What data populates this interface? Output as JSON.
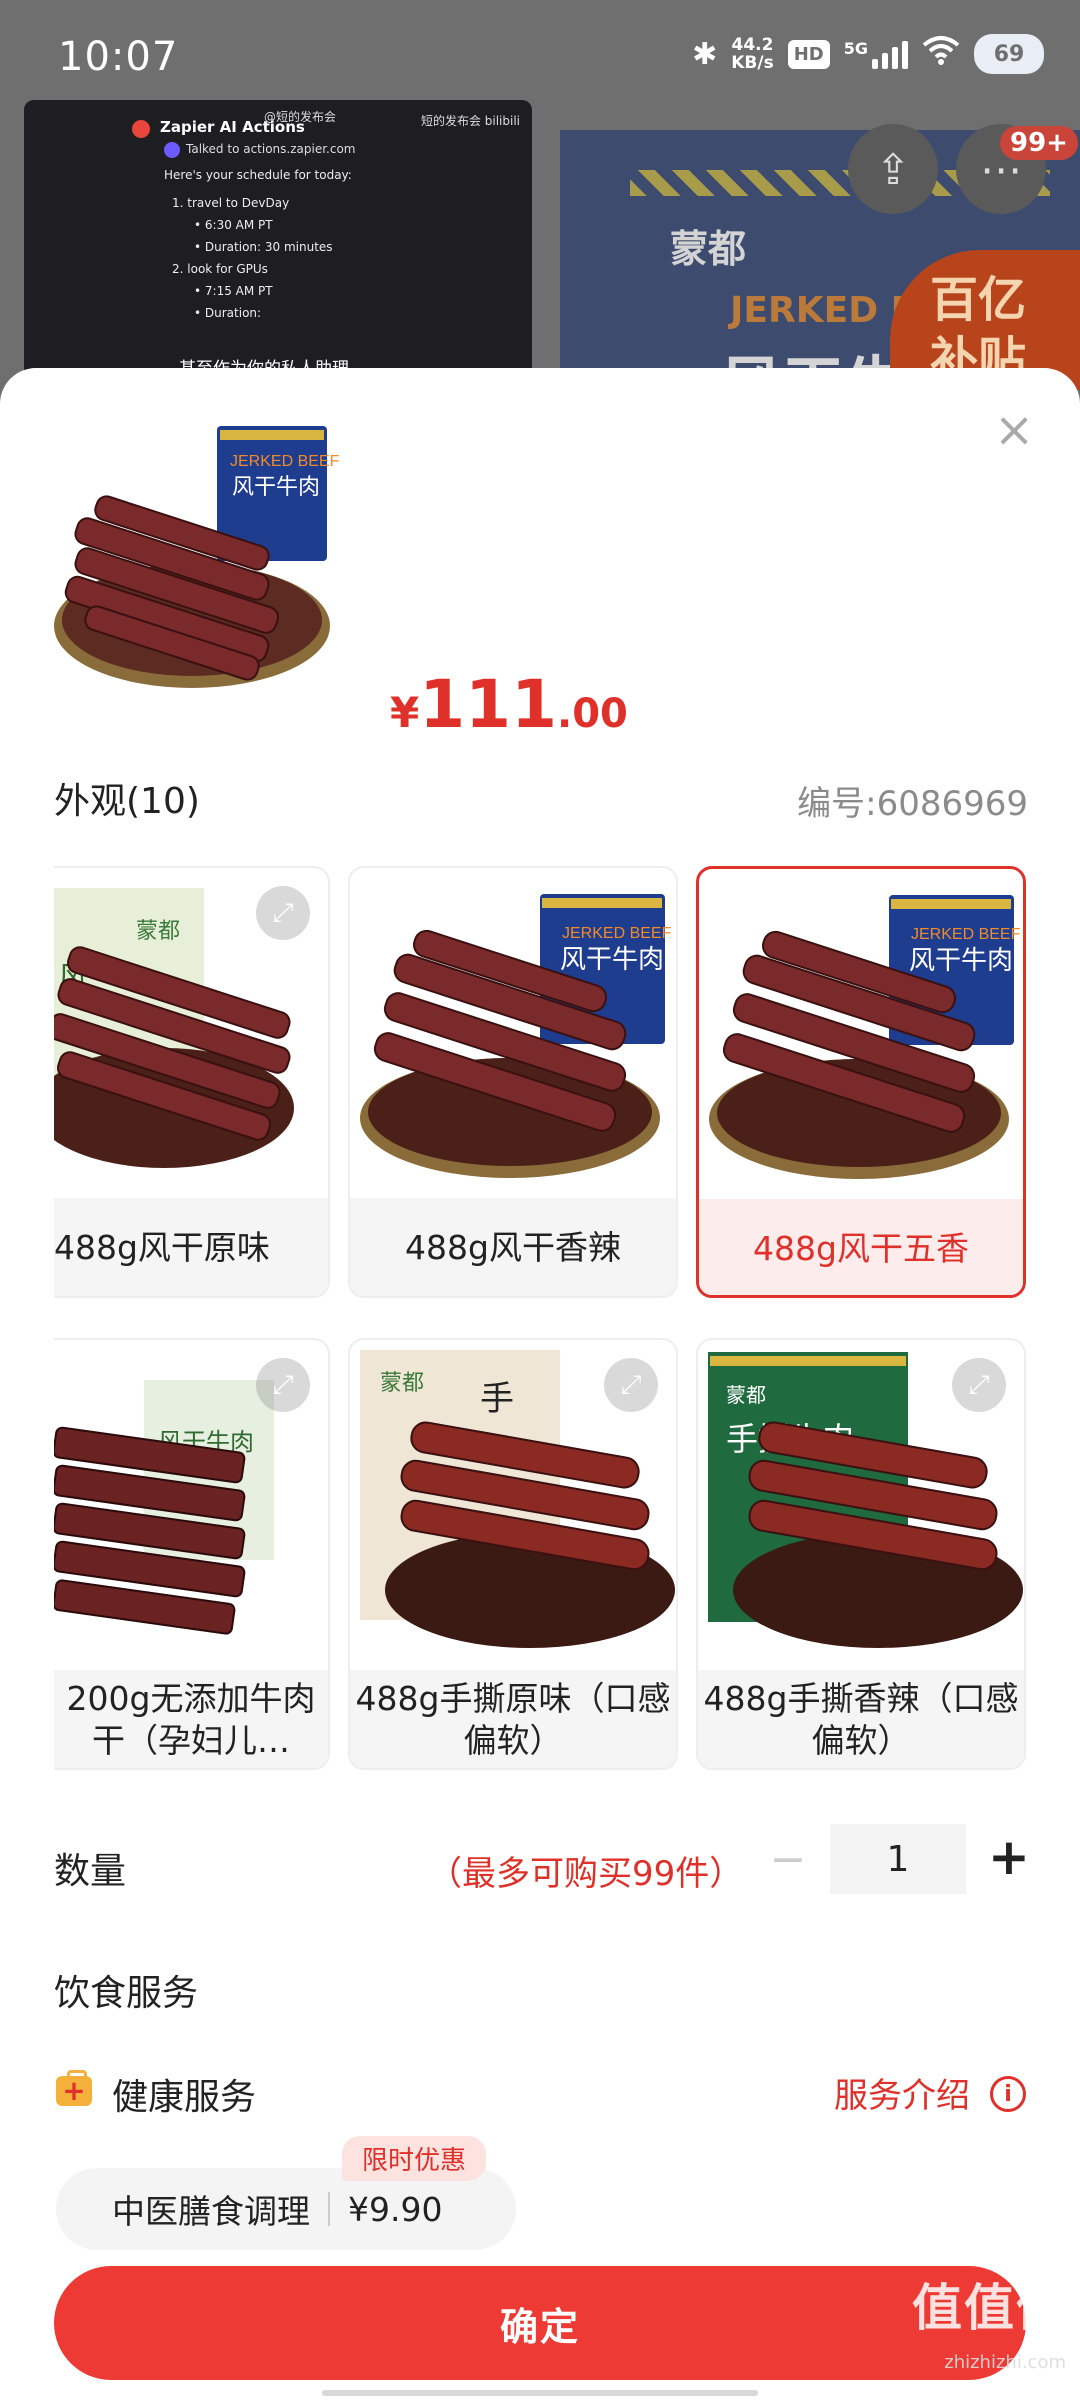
{
  "status_bar": {
    "time": "10:07",
    "net_speed_value": "44.2",
    "net_speed_unit": "KB/s",
    "hd": "HD",
    "network": "5G",
    "battery": "69"
  },
  "background_page": {
    "brand": "蒙都",
    "jerked_text": "JERKED BEEF",
    "product_big": "风干牛",
    "badge_line1": "百亿",
    "badge_line2": "补贴",
    "cart_count": "99+"
  },
  "video": {
    "wm_left": "@短的发布会",
    "wm_right": "短的发布会 bilibili",
    "title": "Zapier AI Actions",
    "talked": "Talked to actions.zapier.com",
    "intro": "Here's your schedule for today:",
    "item1": "1.  travel to DevDay",
    "item1a": "• 6:30 AM PT",
    "item1b": "• Duration: 30 minutes",
    "item2": "2.  look for GPUs",
    "item2a": "• 7:15 AM PT",
    "item2b": "• Duration:",
    "subtitle": "甚至作为你的私人助理"
  },
  "sheet": {
    "price_currency": "¥",
    "price_int": "111",
    "price_dec": ".00",
    "appearance_title": "外观(10)",
    "sku_code": "编号:6086969",
    "options": [
      {
        "label": "488g风干原味"
      },
      {
        "label": "488g风干香辣"
      },
      {
        "label": "488g风干五香"
      },
      {
        "label": "200g无添加牛肉干（孕妇儿…"
      },
      {
        "label": "488g手撕原味（口感偏软）"
      },
      {
        "label": "488g手撕香辣（口感偏软）"
      }
    ],
    "quantity_title": "数量",
    "quantity_limit": "（最多可购买99件）",
    "quantity_value": "1",
    "minus": "−",
    "plus": "+",
    "diet_title": "饮食服务",
    "health_label": "健康服务",
    "service_intro": "服务介绍",
    "info": "i",
    "service_name": "中医膳食调理",
    "service_price": "¥9.90",
    "promo": "限时优惠",
    "confirm": "确定"
  },
  "watermark": {
    "main": "值值值",
    "small": "zhizhizhi.com"
  },
  "colors": {
    "accent": "#e0302a",
    "confirm_bg": "#ee3a34",
    "selected_bg": "#fcecec"
  }
}
